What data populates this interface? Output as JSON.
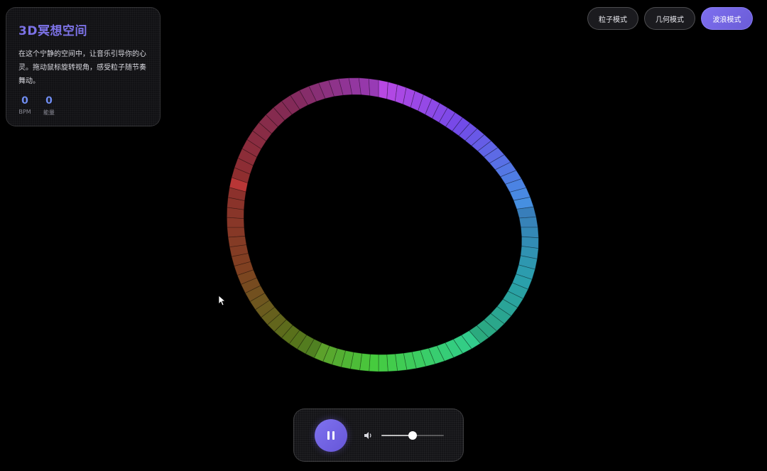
{
  "info": {
    "title": "3D冥想空间",
    "description": "在这个宁静的空间中，让音乐引导你的心灵。拖动鼠标旋转视角，感受粒子随节奏舞动。",
    "stats": [
      {
        "value": "0",
        "label": "BPM"
      },
      {
        "value": "0",
        "label": "能量"
      }
    ]
  },
  "modes": [
    {
      "label": "粒子模式",
      "active": false
    },
    {
      "label": "几何模式",
      "active": false
    },
    {
      "label": "波浪模式",
      "active": true
    }
  ],
  "player": {
    "play_icon": "pause-icon",
    "volume_icon": "speaker-icon",
    "volume": 0.5
  },
  "visualizer": {
    "type": "wave-ring",
    "colors": [
      "#c24cf0",
      "#7a4df5",
      "#4f8cf0",
      "#35c8d8",
      "#36d98a",
      "#4ad642",
      "#6e8f22",
      "#a0502a",
      "#b33a3a",
      "#a33570"
    ],
    "highlight_color": "#e84444"
  }
}
